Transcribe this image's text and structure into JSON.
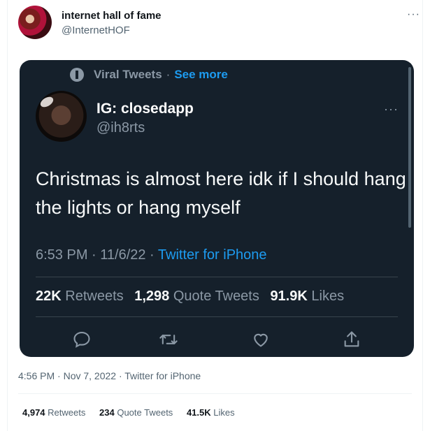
{
  "outer": {
    "author_name": "internet hall of fame",
    "author_handle": "@InternetHOF",
    "more_label": "···",
    "timestamp": "4:56 PM · Nov 7, 2022 · Twitter for iPhone",
    "retweets_count": "4,974",
    "retweets_label": "Retweets",
    "quotes_count": "234",
    "quotes_label": "Quote Tweets",
    "likes_count": "41.5K",
    "likes_label": "Likes"
  },
  "embed": {
    "context_label": "Viral Tweets",
    "context_sep": "·",
    "see_more": "See more",
    "author_name": "IG: closedapp",
    "author_handle": "@ih8rts",
    "more_label": "···",
    "text": "Christmas is almost here idk if I should hang the lights or hang myself",
    "time_date": "6:53 PM · 11/6/22 · ",
    "source": "Twitter for iPhone",
    "retweets_count": "22K",
    "retweets_label": "Retweets",
    "quotes_count": "1,298",
    "quotes_label": "Quote Tweets",
    "likes_count": "91.9K",
    "likes_label": "Likes"
  },
  "icons": [
    "reply-icon",
    "retweet-icon",
    "like-icon",
    "share-icon"
  ],
  "colors": {
    "embed_bg": "#15202b",
    "accent": "#1d9bf0",
    "muted": "#8b98a5"
  }
}
